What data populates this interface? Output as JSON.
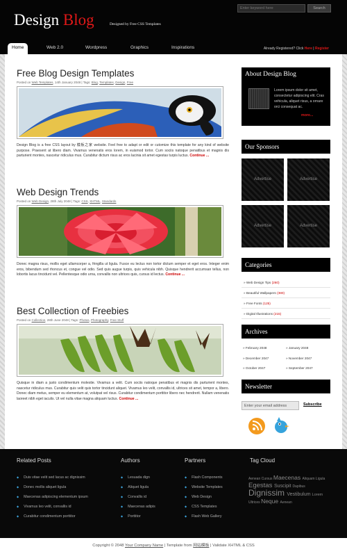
{
  "header": {
    "logo_word1": "Design",
    "logo_word2": "Blog",
    "tagline": "Designed by Free CSS Templates",
    "search_placeholder": "Enter keyword here",
    "search_button": "Search",
    "login_text": "Already Registered? Click",
    "login_link": "Here",
    "login_sep": "|",
    "register_link": "Register"
  },
  "nav": [
    "Home",
    "Web 2.0",
    "Wordpress",
    "Graphics",
    "Inspirations"
  ],
  "posts": [
    {
      "title": "Free Blog Design Templates",
      "meta_prefix": "Posted on",
      "meta_cat": "Web Templates",
      "meta_date": ", 14th January 2048 | Tags:",
      "meta_tags": [
        "Blog",
        "Templates",
        "Design",
        "Free"
      ],
      "excerpt": "Design Blog is a free CSS layout by 模板之家 website. Feel free to adapt or edit or cutomize this template for any kind of website purpose. Praesent at libero diam. Vivamus venenatis eros lorem, in euismod tortor. Cum sociis natoque penatibus et magnis dis parturient montes, nascetur ridiculus mus. Curabitur dictum risus ac eros lacinia sit amet egestas turpis luctus.",
      "continue": "Continue ..."
    },
    {
      "title": "Web Design Trends",
      "meta_prefix": "Posted on",
      "meta_cat": "Web Design",
      "meta_date": ", 28th July 2048 | Tags:",
      "meta_tags": [
        "CSS",
        "XHTML",
        "Standards"
      ],
      "excerpt": "Donec magna risus, mollis eget ullamcorper a, fringilla ut ligula. Fusce eu lectus non tortor dictum semper et eget eros. Integer enim eros, bibendum sed rhoncus et, congue vel odio. Sed quis augue turpis, quis vehicula nibh. Quisque hendrerit accumsan tellus, non lobortis lacus tincidunt vel. Pellentesque odio urna, convallis non ultrices quis, cursus id lectus.",
      "continue": "Continue ..."
    },
    {
      "title": "Best Collection of Freebies",
      "meta_prefix": "Posted on",
      "meta_cat": "Collection",
      "meta_date": ", 28th June 2048 | Tags:",
      "meta_tags": [
        "Photos",
        "Photography",
        "Free Stuff"
      ],
      "excerpt": "Quisque in diam a justo condimentum molestie. Vivamus a velit. Cum sociis natoque penatibus et magnis dis parturient montes, nascetur ridiculus mus. Curabitur quis velit quis tortor tincidunt aliquet. Vivamus leo velit, convallis id, ultrices sit amet, tempor a, libero. Donec diam metus, semper eu elementum at, volutpat vel risus. Curabitur condimentum porttitor libero nec hendrerit. Nullam venenatis laoreet nibh eget iaculis. Ut vel nulla vitae magna aliquam luctus.",
      "continue": "Continue ..."
    }
  ],
  "sidebar": {
    "about_title": "About Design Blog",
    "about_text": "Lorem ipsum dolor sit amet, consectetur adipiscing elit. Cras vehicula, aliquet risus, a ornare orci consequat ac.",
    "about_more": "more...",
    "sponsors_title": "Our Sponsors",
    "ad_label": "Advertise",
    "categories_title": "Categories",
    "categories": [
      {
        "name": "Web Design Tips",
        "count": "(260)"
      },
      {
        "name": "Beautiful Wallpapers",
        "count": "(380)"
      },
      {
        "name": "Free Fonts",
        "count": "(125)"
      },
      {
        "name": "Digital Illustrations",
        "count": "(215)"
      }
    ],
    "archives_title": "Archives",
    "archives": [
      "February 2048",
      "January 2048",
      "December 2047",
      "November 2047",
      "October 2047",
      "September 2047"
    ],
    "newsletter_title": "Newsletter",
    "newsletter_placeholder": "Enter your email address",
    "subscribe": "Subscribe"
  },
  "footer": {
    "related_title": "Related Posts",
    "related": [
      "Duis vitae velit sed lacus ac dignissim",
      "Donec mollis aliquet ligula",
      "Maecenas adipiscing elementum ipsum",
      "Vivamus leo velit, convallis id",
      "Curabitur condimentum porttitor"
    ],
    "authors_title": "Authors",
    "authors": [
      "Lesuada dign",
      "Aliquet ligula",
      "Convallis id",
      "Maecenas adipis",
      "Porttitor"
    ],
    "partners_title": "Partners",
    "partners": [
      "Flash Components",
      "Website Templates",
      "Web Design",
      "CSS Templates",
      "Flash Web Gallery"
    ],
    "tagcloud_title": "Tag Cloud",
    "tags": [
      {
        "t": "Aenean",
        "s": 5
      },
      {
        "t": "Cursus",
        "s": 5
      },
      {
        "t": "Maecenas",
        "s": 8.5
      },
      {
        "t": "Aliquam",
        "s": 5
      },
      {
        "t": "Ligula",
        "s": 5
      },
      {
        "t": "Egestas",
        "s": 9.5
      },
      {
        "t": "Suscipit",
        "s": 7
      },
      {
        "t": "Dapibus",
        "s": 5
      },
      {
        "t": "Dignissim",
        "s": 12
      },
      {
        "t": "Vestibulum",
        "s": 7
      },
      {
        "t": "Lorem",
        "s": 5.5
      },
      {
        "t": "Ultrices",
        "s": 5
      },
      {
        "t": "Neque",
        "s": 8.5
      },
      {
        "t": "Aenean",
        "s": 5
      }
    ]
  },
  "copyright": {
    "prefix": "Copyright © 2048",
    "company": "Your Company Name",
    "middle": "| Template from",
    "source": "网站模板",
    "suffix": "| Validate XHTML & CSS"
  }
}
